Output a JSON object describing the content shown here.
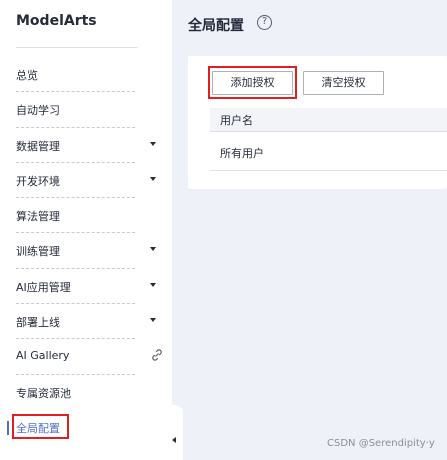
{
  "sidebar": {
    "brand": "ModelArts",
    "items": [
      {
        "label": "总览"
      },
      {
        "label": "自动学习"
      },
      {
        "label": "数据管理"
      },
      {
        "label": "开发环境"
      },
      {
        "label": "算法管理"
      },
      {
        "label": "训练管理"
      },
      {
        "label": "AI应用管理"
      },
      {
        "label": "部署上线"
      },
      {
        "label": "AI Gallery"
      },
      {
        "label": "专属资源池"
      },
      {
        "label": "全局配置"
      }
    ],
    "active_item": "全局配置",
    "accent_color": "#526ecc"
  },
  "main": {
    "title": "全局配置",
    "help_icon": "question-circle-icon",
    "toolbar": {
      "add_label": "添加授权",
      "clear_label": "清空授权"
    },
    "table": {
      "columns": [
        "用户名"
      ],
      "rows": [
        [
          "所有用户"
        ]
      ]
    }
  },
  "annotation": {
    "highlight_color": "#e02020"
  },
  "watermark": "CSDN @Serendipity·y"
}
